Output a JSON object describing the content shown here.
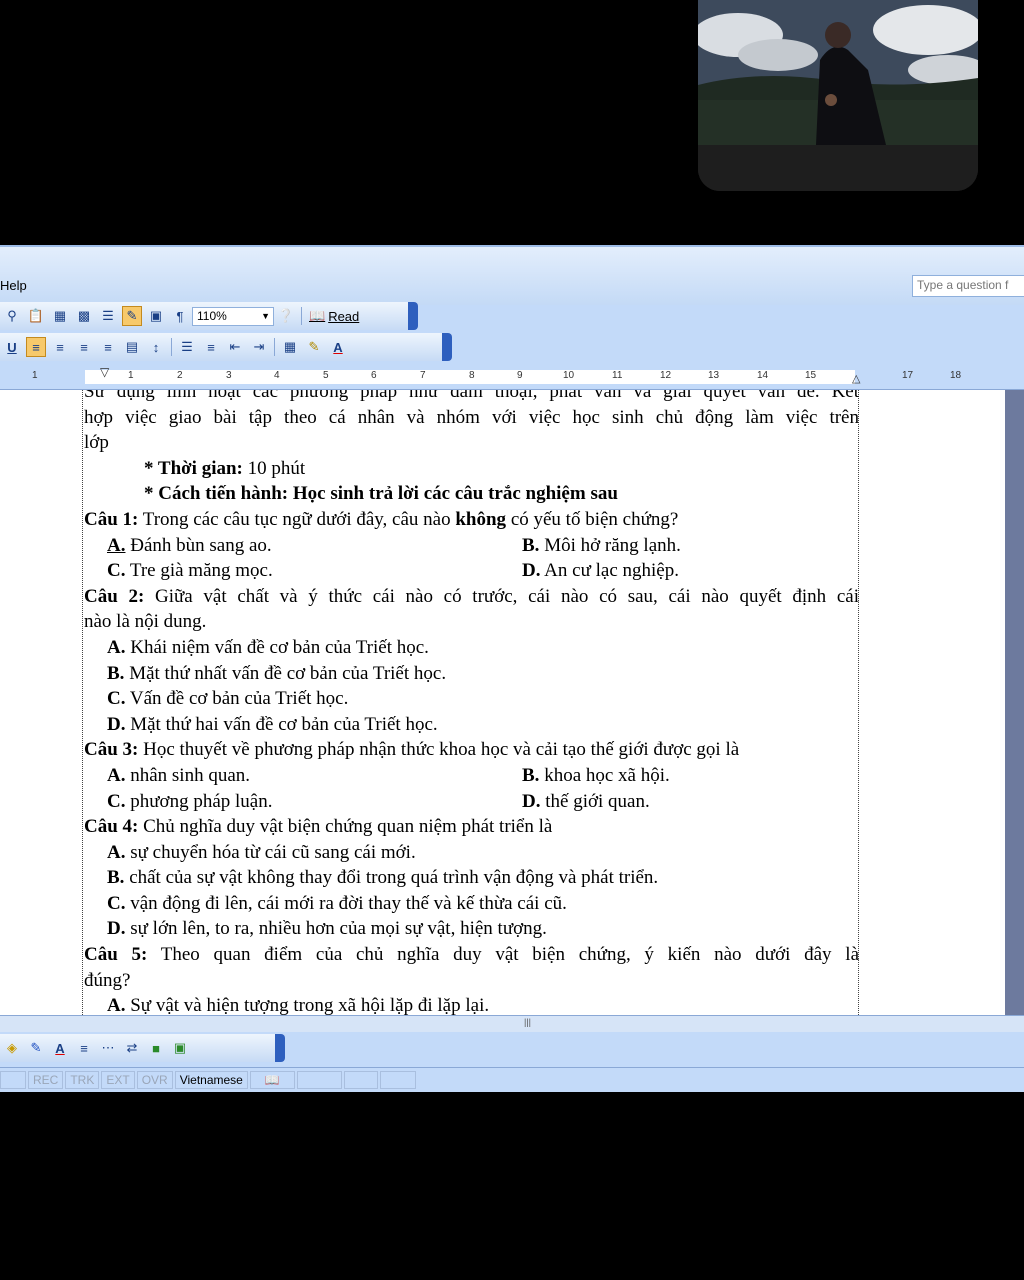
{
  "menu": {
    "help_label": "Help",
    "ask_placeholder": "Type a question f"
  },
  "toolbar": {
    "zoom_value": "110%",
    "read_label": "Read"
  },
  "ruler": {
    "labels": [
      "1",
      "1",
      "2",
      "3",
      "4",
      "5",
      "6",
      "7",
      "8",
      "9",
      "10",
      "11",
      "12",
      "13",
      "14",
      "15",
      "17",
      "18"
    ]
  },
  "document": {
    "l0": "Sử dụng linh hoạt các phương pháp như đàm thoại, phát vấn và giải quyết vấn đề. Kết",
    "l1": "hợp việc giao bài tập theo cá nhân và nhóm với việc học sinh chủ động làm việc trên",
    "l2": "lớp",
    "time_label": "* Thời gian:",
    "time_value": " 10 phút",
    "method": "* Cách tiến hành: Học sinh trả lời các câu trắc nghiệm sau",
    "q1_num": "Câu 1:",
    "q1_a": " Trong các câu tục ngữ dưới đây, câu nào ",
    "q1_b": "không",
    "q1_c": " có yếu tố biện chứng?",
    "q1_A": "A.",
    "q1_A_t": " Đánh bùn sang ao.",
    "q1_B": "B.",
    "q1_B_t": " Môi hở răng lạnh.",
    "q1_C": "C.",
    "q1_C_t": " Tre già măng mọc.",
    "q1_D": "D.",
    "q1_D_t": " An cư lạc nghiệp.",
    "q2_num": "Câu 2:",
    "q2_l1": " Giữa vật chất và ý thức cái nào có trước, cái nào có sau, cái nào quyết định cái",
    "q2_l2": "nào là nội dung.",
    "q2_A": "A.",
    "q2_A_t": " Khái niệm vấn đề cơ bản của Triết học.",
    "q2_B": "B.",
    "q2_B_t": " Mặt thứ nhất vấn đề cơ bản của Triết học.",
    "q2_C": "C.",
    "q2_C_t": " Vấn đề cơ bản của Triết học.",
    "q2_D": "D.",
    "q2_D_t": " Mặt thứ hai vấn đề cơ bản của Triết học.",
    "q3_num": "Câu 3:",
    "q3_t": " Học thuyết về phương pháp nhận thức khoa học và cải tạo thế giới được gọi là",
    "q3_A": "A.",
    "q3_A_t": " nhân sinh quan.",
    "q3_B": "B.",
    "q3_B_t": " khoa học xã hội.",
    "q3_C": "C.",
    "q3_C_t": " phương pháp luận.",
    "q3_D": "D.",
    "q3_D_t": " thế giới quan.",
    "q4_num": "Câu 4:",
    "q4_t": " Chủ nghĩa duy vật biện chứng quan niệm phát triển là",
    "q4_A": "A.",
    "q4_A_t": " sự chuyển hóa từ cái cũ sang cái mới.",
    "q4_B": "B.",
    "q4_B_t": " chất của sự vật không thay đổi trong quá trình vận động và phát triển.",
    "q4_C": "C.",
    "q4_C_t": " vận động đi lên, cái mới ra đời thay thế và kế thừa cái cũ.",
    "q4_D": "D.",
    "q4_D_t": " sự lớn lên, to ra, nhiều hơn của mọi sự vật, hiện tượng.",
    "q5_num": "Câu 5:",
    "q5_l1": " Theo quan điểm của chủ nghĩa duy vật biện chứng, ý kiến nào dưới đây là",
    "q5_l2": "đúng?",
    "q5_A": "A.",
    "q5_A_t": " Sự vật và hiện tượng trong xã hội lặp đi lặp lại."
  },
  "status": {
    "rec": "REC",
    "trk": "TRK",
    "ext": "EXT",
    "ovr": "OVR",
    "language": "Vietnamese"
  },
  "colors": {
    "window_bg": "#c3daf9",
    "toolbar_end": "#2e5fbe",
    "active_button": "#f7c96b"
  }
}
